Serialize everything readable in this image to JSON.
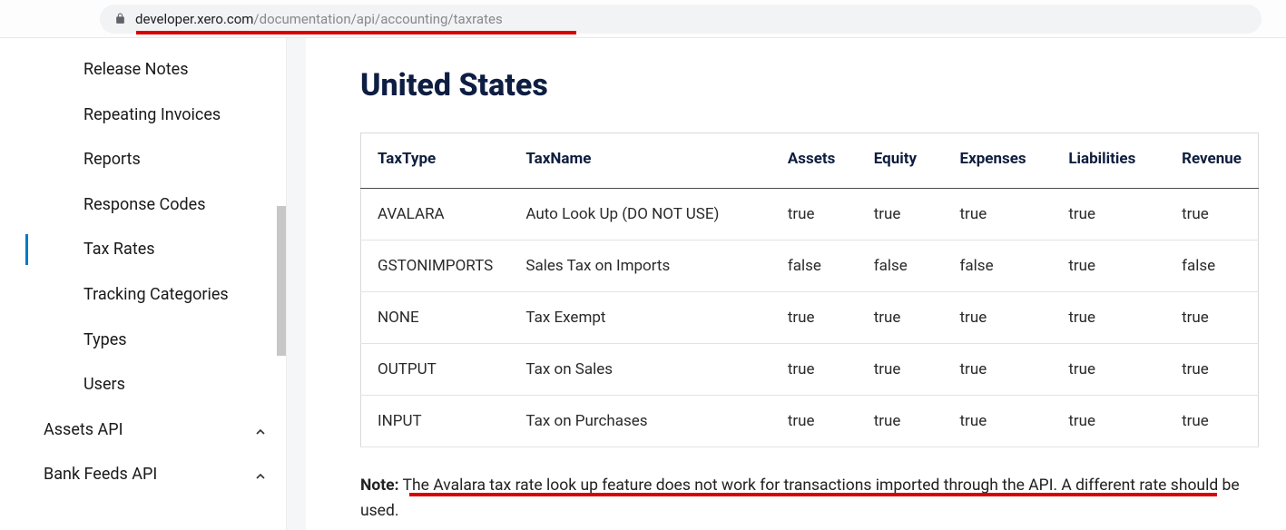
{
  "url": {
    "domain": "developer.xero.com",
    "path": "/documentation/api/accounting/taxrates"
  },
  "sidebar": {
    "items": [
      {
        "label": "Release Notes",
        "active": false
      },
      {
        "label": "Repeating Invoices",
        "active": false
      },
      {
        "label": "Reports",
        "active": false
      },
      {
        "label": "Response Codes",
        "active": false
      },
      {
        "label": "Tax Rates",
        "active": true
      },
      {
        "label": "Tracking Categories",
        "active": false
      },
      {
        "label": "Types",
        "active": false
      },
      {
        "label": "Users",
        "active": false
      }
    ],
    "groups": [
      {
        "label": "Assets API"
      },
      {
        "label": "Bank Feeds API"
      }
    ]
  },
  "content": {
    "heading": "United States",
    "table": {
      "columns": [
        "TaxType",
        "TaxName",
        "Assets",
        "Equity",
        "Expenses",
        "Liabilities",
        "Revenue"
      ],
      "rows": [
        [
          "AVALARA",
          "Auto Look Up (DO NOT USE)",
          "true",
          "true",
          "true",
          "true",
          "true"
        ],
        [
          "GSTONIMPORTS",
          "Sales Tax on Imports",
          "false",
          "false",
          "false",
          "true",
          "false"
        ],
        [
          "NONE",
          "Tax Exempt",
          "true",
          "true",
          "true",
          "true",
          "true"
        ],
        [
          "OUTPUT",
          "Tax on Sales",
          "true",
          "true",
          "true",
          "true",
          "true"
        ],
        [
          "INPUT",
          "Tax on Purchases",
          "true",
          "true",
          "true",
          "true",
          "true"
        ]
      ]
    },
    "note_label": "Note:",
    "note_text": " The Avalara tax rate look up feature does not work for transactions imported through the API. A different rate should be used."
  }
}
